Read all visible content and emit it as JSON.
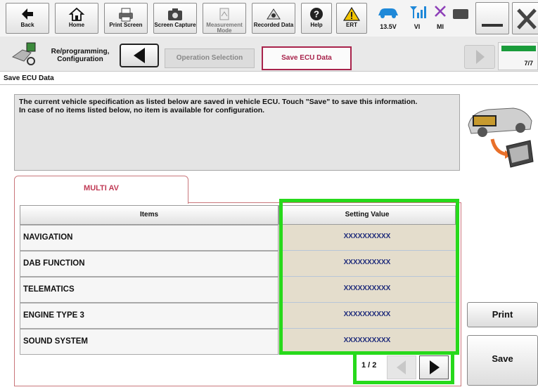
{
  "toolbar": {
    "back_label": "Back",
    "home_label": "Home",
    "print_screen_label": "Print Screen",
    "screen_capture_label": "Screen Capture",
    "measurement_mode_label": "Measurement Mode",
    "recorded_data_label": "Recorded Data",
    "help_label": "Help",
    "ert_label": "ERT",
    "voltage": "13.5V",
    "vi_label": "VI",
    "mi_label": "MI"
  },
  "breadcrumb": {
    "mode_label": "Re/programming, Configuration",
    "step1": "Operation Selection",
    "step2": "Save ECU Data",
    "progress_fraction": 1.0,
    "progress_text": "7/7"
  },
  "section_title": "Save ECU Data",
  "info": {
    "line1": "The current vehicle specification as listed below are saved in vehicle ECU. Touch \"Save\" to save this information.",
    "line2": "In case of no items listed below, no item is available for configuration."
  },
  "tab_label": "MULTI AV",
  "table": {
    "col_items": "Items",
    "col_value": "Setting Value",
    "rows": [
      {
        "item": "NAVIGATION",
        "value": "XXXXXXXXXX"
      },
      {
        "item": "DAB FUNCTION",
        "value": "XXXXXXXXXX"
      },
      {
        "item": "TELEMATICS",
        "value": "XXXXXXXXXX"
      },
      {
        "item": "ENGINE TYPE 3",
        "value": "XXXXXXXXXX"
      },
      {
        "item": "SOUND SYSTEM",
        "value": "XXXXXXXXXX"
      }
    ]
  },
  "pager": {
    "indicator": "1 / 2"
  },
  "buttons": {
    "print": "Print",
    "save": "Save"
  },
  "colors": {
    "highlight_green": "#27d91b",
    "accent_maroon": "#a8234b",
    "value_bg": "#e4ddcc"
  }
}
